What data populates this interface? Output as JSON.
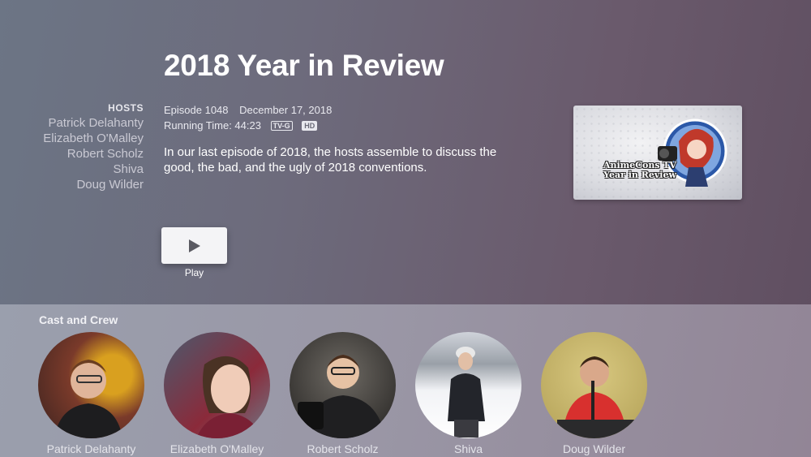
{
  "episode": {
    "title": "2018 Year in Review",
    "number": "Episode 1048",
    "date": "December 17, 2018",
    "running_time": "Running Time: 44:23",
    "rating": "TV-G",
    "quality": "HD",
    "description": "In our last episode of 2018, the hosts assemble to discuss the good, the bad, and the ugly of 2018 conventions."
  },
  "hosts": {
    "label": "HOSTS",
    "names": [
      "Patrick Delahanty",
      "Elizabeth O'Malley",
      "Robert Scholz",
      "Shiva",
      "Doug Wilder"
    ]
  },
  "thumbnail": {
    "caption_line1": "AnimeCons TV",
    "caption_line2": "Year in Review"
  },
  "play": {
    "label": "Play",
    "icon": "play-icon"
  },
  "cast": {
    "title": "Cast and Crew",
    "members": [
      {
        "name": "Patrick Delahanty",
        "bg": "#7a3a2a"
      },
      {
        "name": "Elizabeth O'Malley",
        "bg": "#5a6a7a"
      },
      {
        "name": "Robert Scholz",
        "bg": "#3a3a3a"
      },
      {
        "name": "Shiva",
        "bg": "#d8dbe0"
      },
      {
        "name": "Doug Wilder",
        "bg": "#c9b870"
      }
    ]
  },
  "colors": {
    "accent": "#ffffff",
    "muted": "#c9c9d3"
  }
}
